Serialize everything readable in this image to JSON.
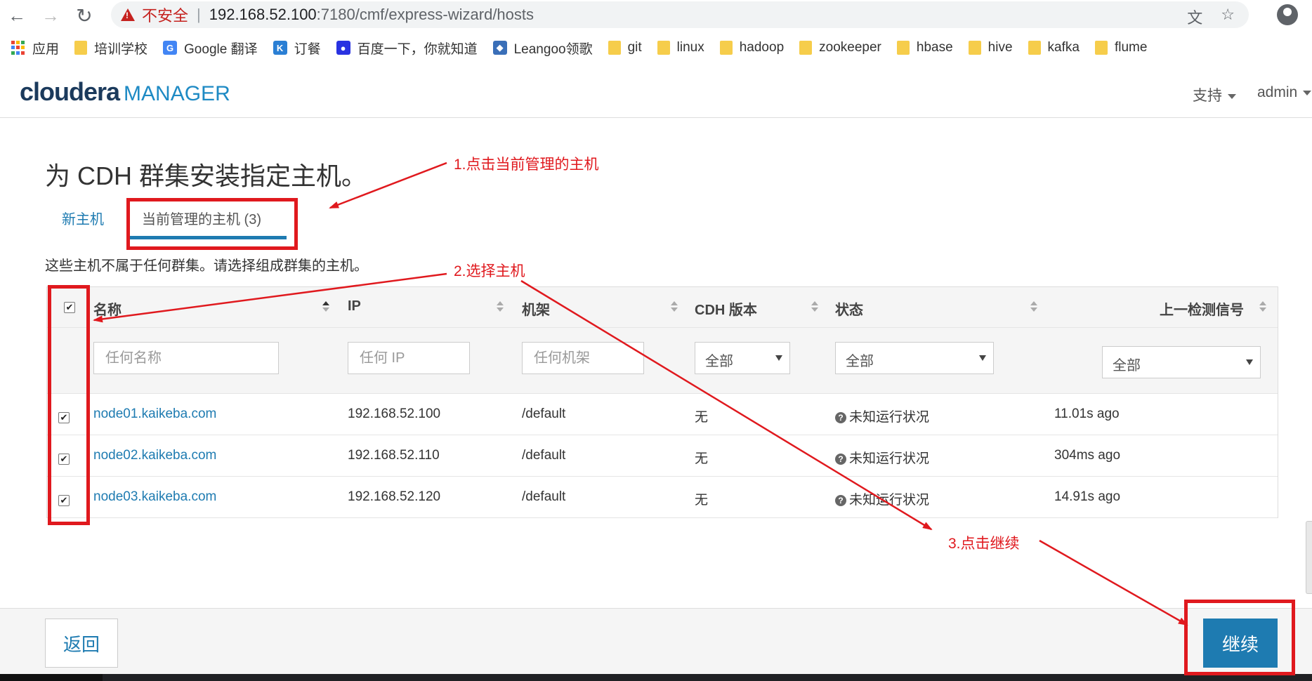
{
  "browser": {
    "insecure_label": "不安全",
    "url_host": "192.168.52.100",
    "url_path": ":7180/cmf/express-wizard/hosts",
    "bookmarks": [
      {
        "label": "应用",
        "icon": "apps-grid-icon"
      },
      {
        "label": "培训学校",
        "icon": "folder-icon"
      },
      {
        "label": "Google 翻译",
        "icon": "google-translate-icon"
      },
      {
        "label": "订餐",
        "icon": "k-app-icon"
      },
      {
        "label": "百度一下，你就知道",
        "icon": "baidu-paw-icon"
      },
      {
        "label": "Leangoo领歌",
        "icon": "leangoo-icon"
      },
      {
        "label": "git",
        "icon": "folder-icon"
      },
      {
        "label": "linux",
        "icon": "folder-icon"
      },
      {
        "label": "hadoop",
        "icon": "folder-icon"
      },
      {
        "label": "zookeeper",
        "icon": "folder-icon"
      },
      {
        "label": "hbase",
        "icon": "folder-icon"
      },
      {
        "label": "hive",
        "icon": "folder-icon"
      },
      {
        "label": "kafka",
        "icon": "folder-icon"
      },
      {
        "label": "flume",
        "icon": "folder-icon"
      }
    ]
  },
  "header": {
    "logo_primary": "cloudera",
    "logo_secondary": "MANAGER",
    "support_label": "支持",
    "user_label": "admin"
  },
  "main": {
    "title": "为 CDH 群集安装指定主机。",
    "tabs": [
      {
        "label": "新主机"
      },
      {
        "label": "当前管理的主机 (3)"
      }
    ],
    "description": "这些主机不属于任何群集。请选择组成群集的主机。"
  },
  "table": {
    "columns": {
      "name": "名称",
      "ip": "IP",
      "rack": "机架",
      "cdh_version": "CDH 版本",
      "status": "状态",
      "last_heartbeat": "上一检测信号"
    },
    "filters": {
      "name_placeholder": "任何名称",
      "ip_placeholder": "任何 IP",
      "rack_placeholder": "任何机架",
      "cdh_version_selected": "全部",
      "status_selected": "全部",
      "heartbeat_selected": "全部"
    },
    "rows": [
      {
        "name": "node01.kaikeba.com",
        "ip": "192.168.52.100",
        "rack": "/default",
        "cdh": "无",
        "status": "未知运行状况",
        "heartbeat": "11.01s ago"
      },
      {
        "name": "node02.kaikeba.com",
        "ip": "192.168.52.110",
        "rack": "/default",
        "cdh": "无",
        "status": "未知运行状况",
        "heartbeat": "304ms ago"
      },
      {
        "name": "node03.kaikeba.com",
        "ip": "192.168.52.120",
        "rack": "/default",
        "cdh": "无",
        "status": "未知运行状况",
        "heartbeat": "14.91s ago"
      }
    ]
  },
  "footer": {
    "back_label": "返回",
    "continue_label": "继续"
  },
  "annotations": {
    "step1": "1.点击当前管理的主机",
    "step2": "2.选择主机",
    "step3": "3.点击继续",
    "color": "#e0191e"
  },
  "colors": {
    "accent": "#1e7bb1",
    "logo_dark": "#1b3a5c",
    "insecure": "#c5221f"
  }
}
